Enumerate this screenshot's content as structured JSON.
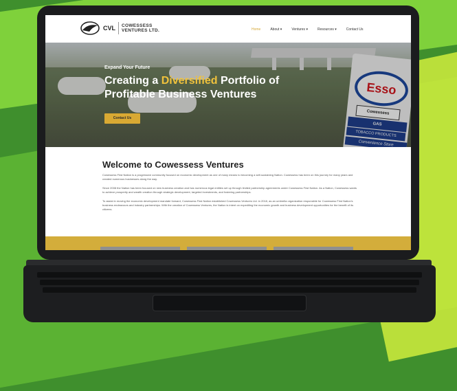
{
  "site": {
    "logo_initials": "CVL",
    "logo_line1": "COWESSESS",
    "logo_line2": "VENTURES LTD."
  },
  "nav": {
    "items": [
      {
        "label": "Home",
        "active": true
      },
      {
        "label": "About ▾",
        "active": false
      },
      {
        "label": "Ventures ▾",
        "active": false
      },
      {
        "label": "Resources ▾",
        "active": false
      },
      {
        "label": "Contact Us",
        "active": false
      }
    ]
  },
  "hero": {
    "kicker": "Expand Your Future",
    "headline_pre": "Creating a ",
    "headline_highlight": "Diversified",
    "headline_post": " Portfolio of Profitable Business Ventures",
    "cta": "Contact Us",
    "sign_brand": "Esso",
    "sign_store": "Cowessess",
    "sign_row1": "GAS",
    "sign_row2": "TOBACCO PRODUCTS",
    "sign_row3": "Convenience Store"
  },
  "main": {
    "title": "Welcome to Cowessess Ventures",
    "p1": "Cowessess First Nation is a progressive community focused on economic development as one of many means to becoming a self-sustaining Nation. Cowessess has been on this journey for many years and created numerous businesses along the way.",
    "p2": "Since 2008 the Nation has been focused on new business creation and has numerous legal entities set up through limited partnership agreements under Cowessess First Nation. As a Nation, Cowessess wants to achieve prosperity and wealth creation through strategic development, targeted investments, and fostering partnerships.",
    "p3": "To assist in moving the economic development mandate forward, Cowessess First Nation established Cowessess Ventures Ltd. in 2018, as an umbrella organization responsible for Cowessess First Nation's business endeavours and industry partnerships. With the creation of Cowessess Ventures, the Nation is intent on expediting the economic growth and business development opportunities for the benefit of its citizens."
  },
  "colors": {
    "accent": "#d9a933",
    "highlight": "#f0c23c",
    "background_green": "#5bb233"
  }
}
